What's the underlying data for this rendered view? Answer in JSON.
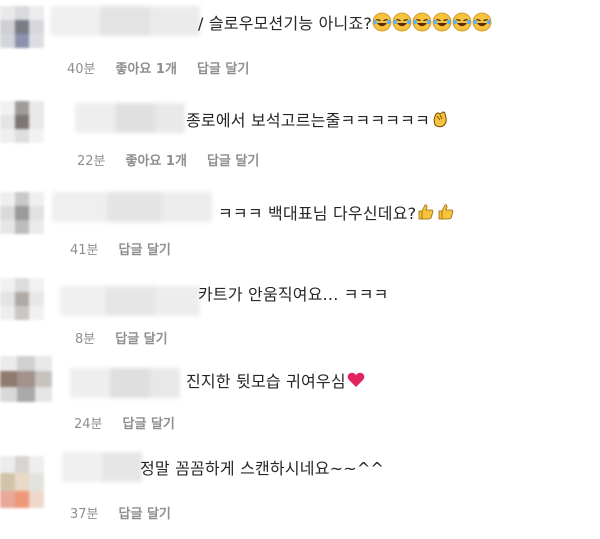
{
  "comments": [
    {
      "text": "/ 슬로우모션기능 아니죠?",
      "time": "40분",
      "likes": "좋아요 1개",
      "reply": "답글 달기",
      "emoji": "laughing-tears-icon",
      "emoji_count": 6
    },
    {
      "text": "종로에서 보석고르는줄ㅋㅋㅋㅋㅋㅋ",
      "time": "22분",
      "likes": "좋아요 1개",
      "reply": "답글 달기",
      "emoji": "clapping-hand-icon",
      "emoji_count": 1
    },
    {
      "text": "ㅋㅋㅋ 백대표님 다우신데요?",
      "time": "41분",
      "likes": "",
      "reply": "답글 달기",
      "emoji": "thumbs-up-icon",
      "emoji_count": 2
    },
    {
      "text": "카트가 안움직여요... ㅋㅋㅋ",
      "time": "8분",
      "likes": "",
      "reply": "답글 달기",
      "emoji": "",
      "emoji_count": 0
    },
    {
      "text": "진지한 뒷모습 귀여우심",
      "time": "24분",
      "likes": "",
      "reply": "답글 달기",
      "emoji": "red-heart-icon",
      "emoji_count": 1
    },
    {
      "text": "정말 꼼꼼하게 스캔하시네요~~^^",
      "time": "37분",
      "likes": "",
      "reply": "답글 달기",
      "emoji": "",
      "emoji_count": 0
    }
  ],
  "colors": {
    "text": "#262626",
    "meta": "#8e8e8e",
    "heart": "#e0245e",
    "emoji_yellow": "#f7c33f"
  }
}
